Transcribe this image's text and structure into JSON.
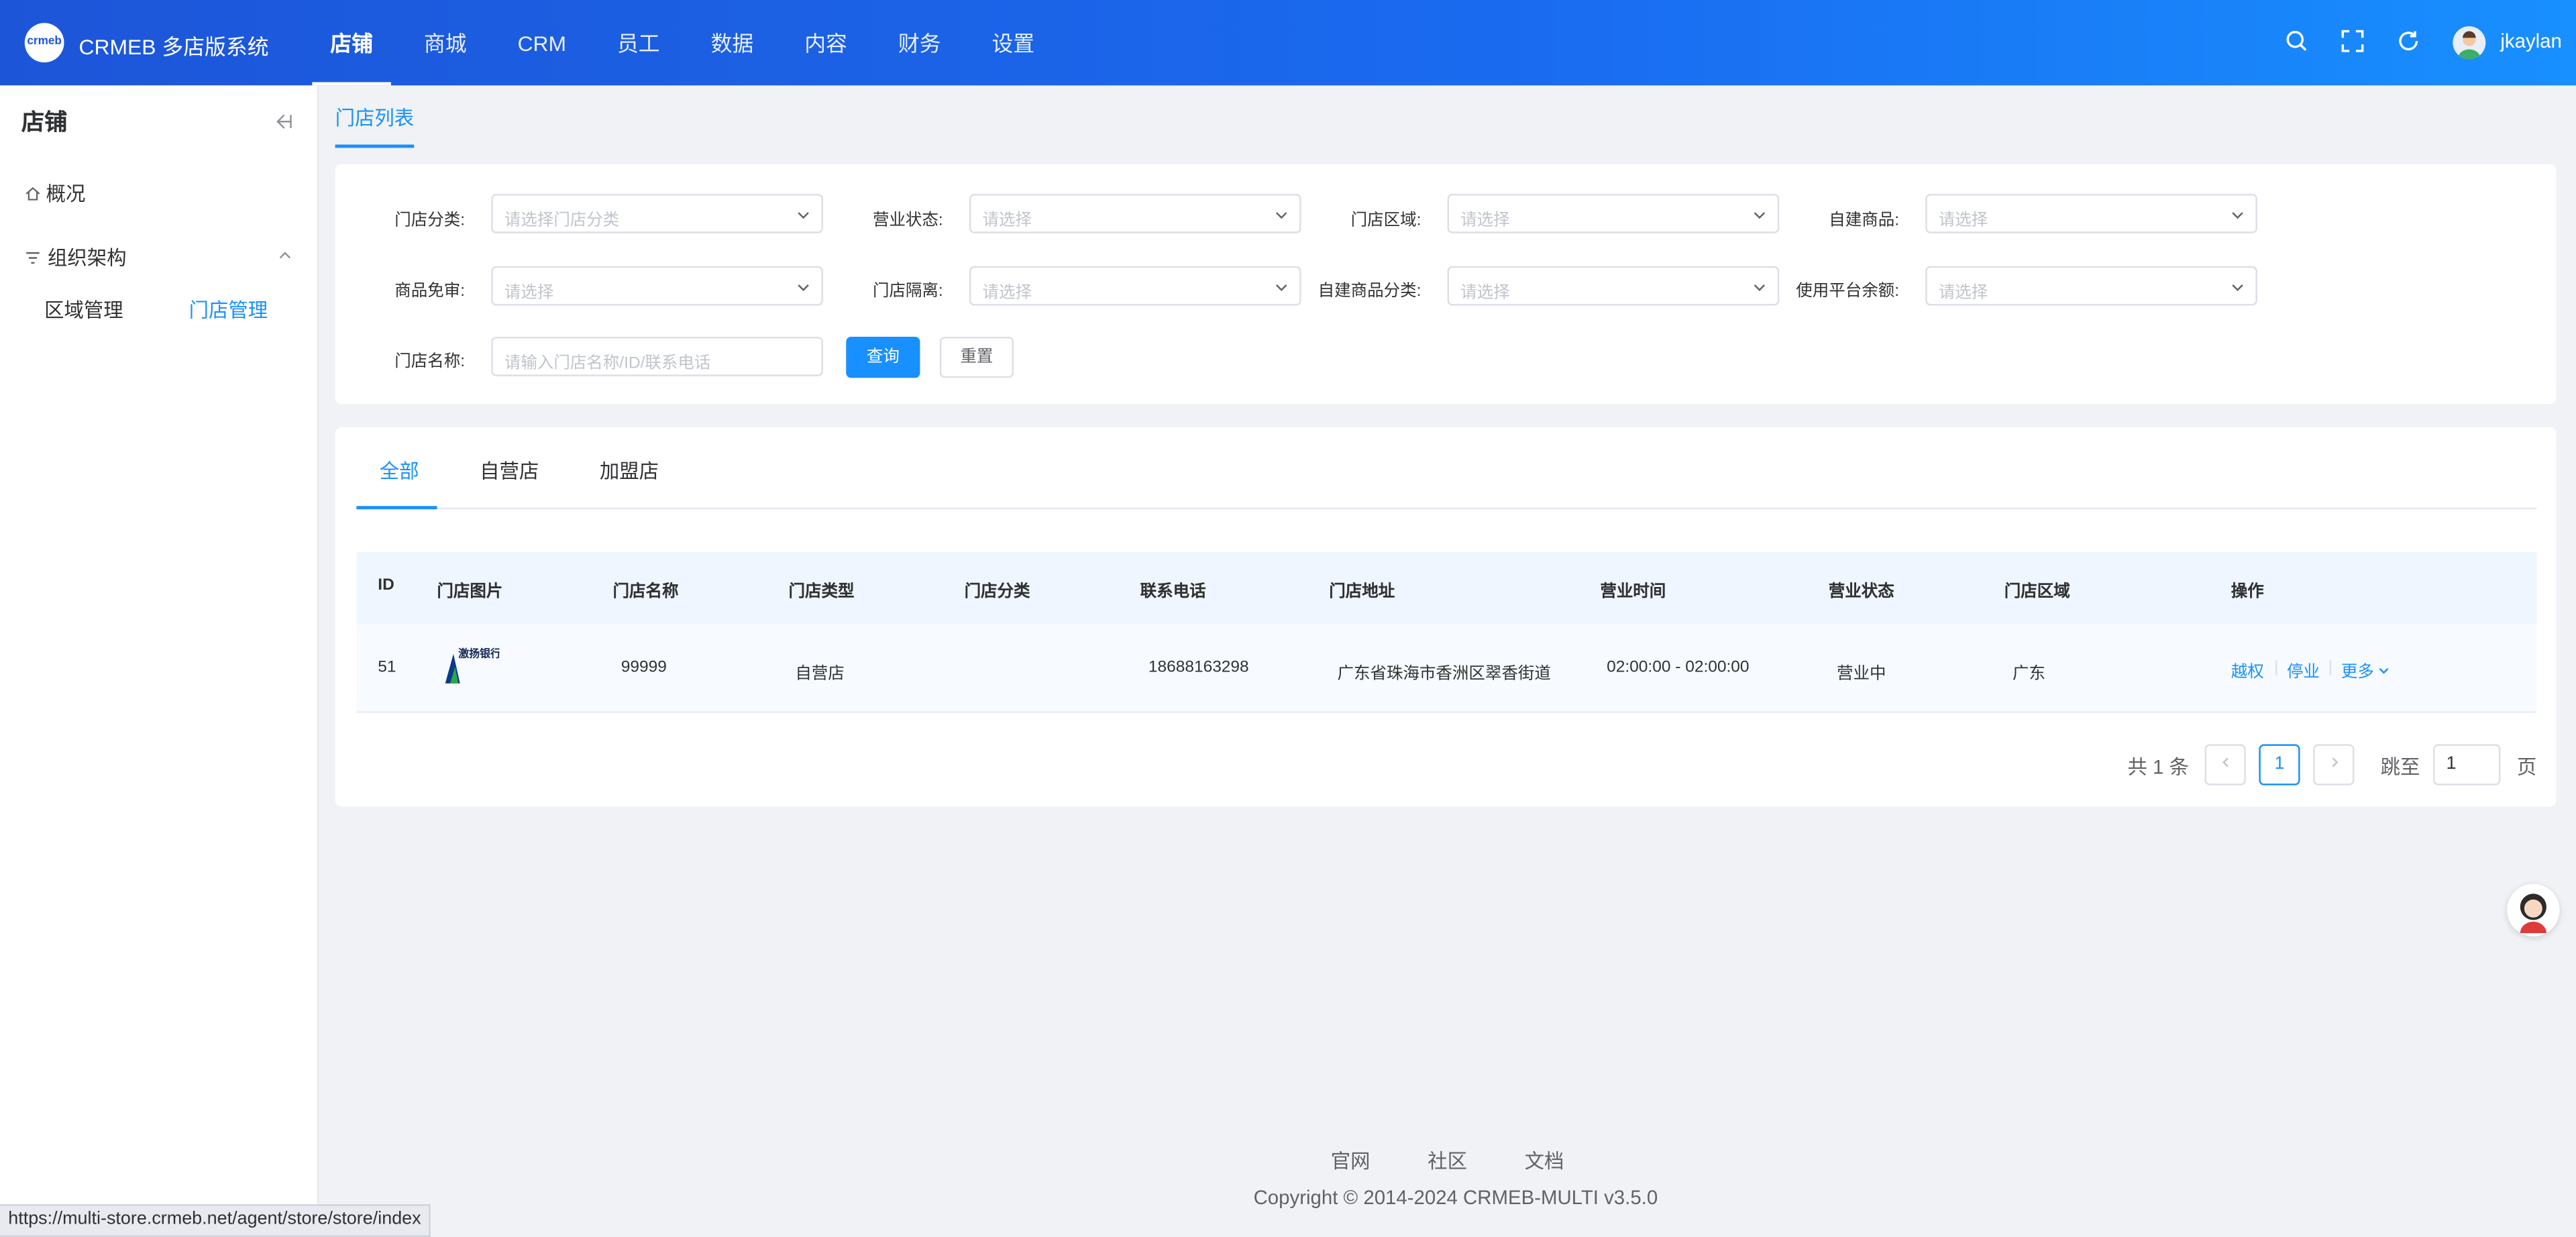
{
  "header": {
    "brand": "CRMEB 多店版系统",
    "logo_text": "crmeb",
    "nav": [
      "店铺",
      "商城",
      "CRM",
      "员工",
      "数据",
      "内容",
      "财务",
      "设置"
    ],
    "active_nav": "店铺",
    "username": "jkaylan",
    "icons": [
      "search-icon",
      "fullscreen-icon",
      "refresh-icon",
      "avatar"
    ]
  },
  "sidebar": {
    "title": "店铺",
    "overview": "概况",
    "group": "组织架构",
    "sub_items": [
      "区域管理",
      "门店管理"
    ],
    "active_sub": "门店管理"
  },
  "breadcrumb": "门店列表",
  "filters": {
    "category_label": "门店分类:",
    "category_placeholder": "请选择门店分类",
    "status_label": "营业状态:",
    "status_placeholder": "请选择",
    "region_label": "门店区域:",
    "region_placeholder": "请选择",
    "own_goods_label": "自建商品:",
    "own_goods_placeholder": "请选择",
    "goods_exempt_label": "商品免审:",
    "goods_exempt_placeholder": "请选择",
    "isolation_label": "门店隔离:",
    "isolation_placeholder": "请选择",
    "own_goods_cat_label": "自建商品分类:",
    "own_goods_cat_placeholder": "请选择",
    "platform_balance_label": "使用平台余额:",
    "platform_balance_placeholder": "请选择",
    "name_label": "门店名称:",
    "name_placeholder": "请输入门店名称/ID/联系电话",
    "query_button": "查询",
    "reset_button": "重置"
  },
  "tabs": [
    "全部",
    "自营店",
    "加盟店"
  ],
  "active_tab": "全部",
  "table": {
    "columns": [
      "ID",
      "门店图片",
      "门店名称",
      "门店类型",
      "门店分类",
      "联系电话",
      "门店地址",
      "营业时间",
      "营业状态",
      "门店区域",
      "操作"
    ],
    "rows": [
      {
        "id": "51",
        "image_text": "激扬银行",
        "name": "99999",
        "type": "自营店",
        "category": "",
        "phone": "18688163298",
        "address": "广东省珠海市香洲区翠香街道",
        "hours": "02:00:00 - 02:00:00",
        "status": "营业中",
        "region": "广东",
        "ops": [
          "越权",
          "停业",
          "更多"
        ]
      }
    ]
  },
  "pagination": {
    "total": "共 1 条",
    "current": "1",
    "jump_label": "跳至",
    "jump_value": "1",
    "page_label": "页"
  },
  "footer": {
    "links": [
      "官网",
      "社区",
      "文档"
    ],
    "copyright": "Copyright © 2014-2024 CRMEB-MULTI v3.5.0"
  },
  "status_url": "https://multi-store.crmeb.net/agent/store/store/index",
  "colors": {
    "primary": "#1890ff",
    "header_start": "#1d55d8"
  }
}
